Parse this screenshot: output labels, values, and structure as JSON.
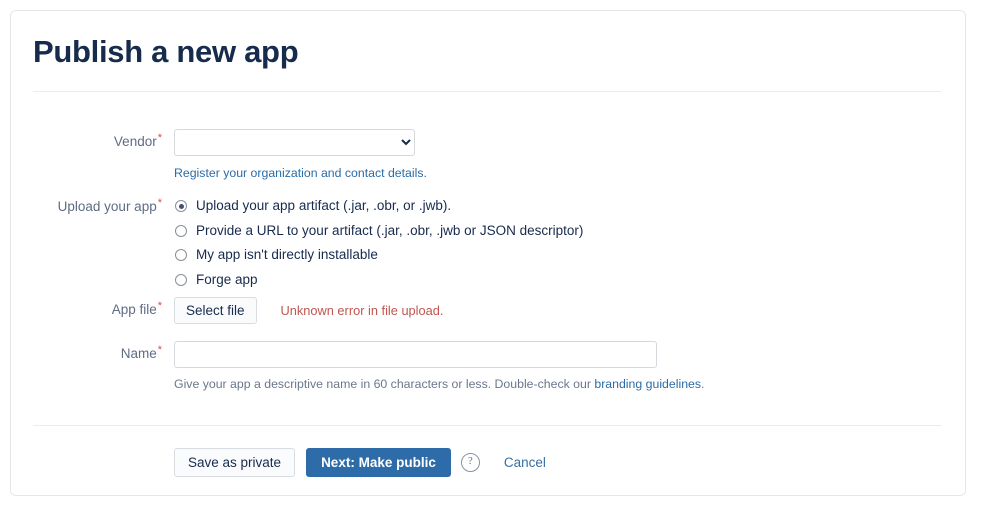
{
  "page": {
    "title": "Publish a new app"
  },
  "form": {
    "vendor": {
      "label": "Vendor",
      "required_marker": "*",
      "selected_value": "",
      "options": [
        ""
      ],
      "helper_link": "Register your organization and contact details."
    },
    "upload": {
      "label": "Upload your app",
      "required_marker": "*",
      "options": [
        {
          "label": "Upload your app artifact (.jar, .obr, or .jwb).",
          "checked": true
        },
        {
          "label": "Provide a URL to your artifact (.jar, .obr, .jwb or JSON descriptor)",
          "checked": false
        },
        {
          "label": "My app isn't directly installable",
          "checked": false
        },
        {
          "label": "Forge app",
          "checked": false
        }
      ]
    },
    "app_file": {
      "label": "App file",
      "required_marker": "*",
      "button_label": "Select file",
      "error_text": "Unknown error in file upload."
    },
    "name": {
      "label": "Name",
      "required_marker": "*",
      "value": "",
      "placeholder": "",
      "helper_prefix": "Give your app a descriptive name in 60 characters or less. Double-check our ",
      "helper_link": "branding guidelines",
      "helper_suffix": "."
    }
  },
  "footer": {
    "save_private_label": "Save as private",
    "next_public_label": "Next: Make public",
    "help_icon_glyph": "?",
    "cancel_label": "Cancel"
  },
  "colors": {
    "title": "#172b4d",
    "primary_button": "#2d6ca8",
    "link": "#2a6ca8",
    "error": "#c0564f",
    "required": "#de4c4c",
    "label": "#5e6c84"
  }
}
